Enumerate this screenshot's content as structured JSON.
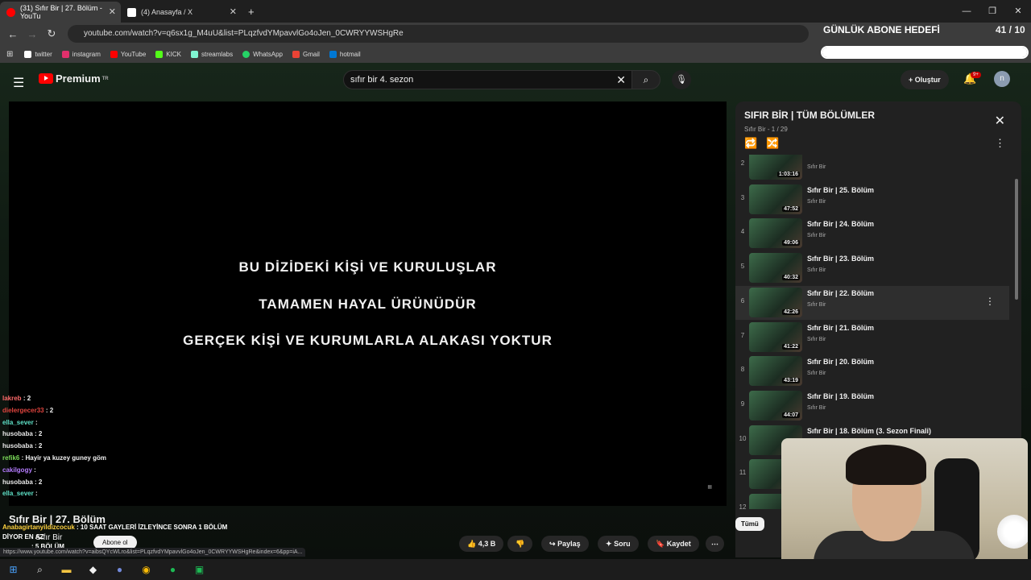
{
  "browser": {
    "tabs": [
      {
        "title": "(31) Sıfır Bir | 27. Bölüm - YouTu",
        "color": "#ff0000"
      },
      {
        "title": "(4) Anasayfa / X",
        "color": "#ffffff"
      }
    ],
    "url": "youtube.com/watch?v=q6sx1g_M4uU&list=PLqzfvdYMpavvlGo4oJen_0CWRYYWSHgRe",
    "bookmarks": [
      {
        "label": "twitter",
        "color": "#ffffff"
      },
      {
        "label": "instagram",
        "color": "#e1306c"
      },
      {
        "label": "YouTube",
        "color": "#ff0000"
      },
      {
        "label": "KICK",
        "color": "#53fc18"
      },
      {
        "label": "streamlabs",
        "color": "#80f5d2"
      },
      {
        "label": "WhatsApp",
        "color": "#25d366"
      },
      {
        "label": "Gmail",
        "color": "#ea4335"
      },
      {
        "label": "hotmail",
        "color": "#0078d4"
      }
    ]
  },
  "youtube": {
    "logo_text": "Premium",
    "logo_sup": "TR",
    "search_value": "sıfır bir 4. sezon",
    "create_label": "Oluştur",
    "notif_badge": "9+",
    "avatar_letter": "n"
  },
  "video": {
    "captions": [
      "BU DİZİDEKİ KİŞİ VE KURULUŞLAR",
      "TAMAMEN HAYAL ÜRÜNÜDÜR",
      "GERÇEK KİŞİ VE KURUMLARLA ALAKASI YOKTUR"
    ],
    "title": "Sıfır Bir | 27. Bölüm",
    "channel": "Sıfır Bir",
    "subscribe_label": "Abone ol",
    "likes": "4,3 B",
    "share_label": "Paylaş",
    "ask_label": "Soru",
    "save_label": "Kaydet"
  },
  "chat": [
    {
      "user": "lakreb",
      "msg": ": 2",
      "color": "#ff6b6b"
    },
    {
      "user": "dielergecer33",
      "msg": ": 2",
      "color": "#e0443e"
    },
    {
      "user": "ella_sever",
      "msg": ":",
      "color": "#5ee0c6"
    },
    {
      "user": "husobaba",
      "msg": ": 2",
      "color": "#e8e8e8"
    },
    {
      "user": "husobaba",
      "msg": ": 2",
      "color": "#e8e8e8"
    },
    {
      "user": "refik6",
      "msg": ": Hayir ya kuzey guney göm",
      "color": "#7cdc5a"
    },
    {
      "user": "cakilgogy",
      "msg": ":",
      "color": "#b57cff"
    },
    {
      "user": "husobaba",
      "msg": ": 2",
      "color": "#e8e8e8"
    },
    {
      "user": "ella_sever",
      "msg": ":",
      "color": "#5ee0c6"
    }
  ],
  "overlay_chat": [
    {
      "user": "Anabagirtanyildizcocuk",
      "msg": ": 10 SAAT GAYLERİ İZLEYİNCE SONRA 1 BÖLÜM"
    },
    {
      "user": "DİYOR EN AZ",
      "msg": ""
    },
    {
      "user": "",
      "msg": ": 5 BÖLÜM"
    }
  ],
  "status_url": "https://www.youtube.com/watch?v=aibsQYcWLro&list=PLqzfvdYMpavvlGo4oJen_0CWRYYWSHgRe&index=6&pp=iA...",
  "playlist": {
    "title": "SIFIR BİR | TÜM BÖLÜMLER",
    "subtitle": "Sıfır Bir - 1 / 29",
    "items": [
      {
        "index": "2",
        "title": "",
        "channel": "Sıfır Bir",
        "duration": "1:03:16"
      },
      {
        "index": "3",
        "title": "Sıfır Bir | 25. Bölüm",
        "channel": "Sıfır Bir",
        "duration": "47:52"
      },
      {
        "index": "4",
        "title": "Sıfır Bir | 24. Bölüm",
        "channel": "Sıfır Bir",
        "duration": "49:06"
      },
      {
        "index": "5",
        "title": "Sıfır Bir | 23. Bölüm",
        "channel": "Sıfır Bir",
        "duration": "40:32"
      },
      {
        "index": "6",
        "title": "Sıfır Bir | 22. Bölüm",
        "channel": "Sıfır Bir",
        "duration": "42:26"
      },
      {
        "index": "7",
        "title": "Sıfır Bir | 21. Bölüm",
        "channel": "Sıfır Bir",
        "duration": "41:22"
      },
      {
        "index": "8",
        "title": "Sıfır Bir | 20. Bölüm",
        "channel": "Sıfır Bir",
        "duration": "43:19"
      },
      {
        "index": "9",
        "title": "Sıfır Bir | 19. Bölüm",
        "channel": "Sıfır Bir",
        "duration": "44:07"
      },
      {
        "index": "10",
        "title": "Sıfır Bir | 18. Bölüm (3. Sezon Finali)",
        "channel": "Sıfır Bir",
        "duration": ""
      },
      {
        "index": "11",
        "title": "",
        "channel": "",
        "duration": ""
      },
      {
        "index": "12",
        "title": "",
        "channel": "",
        "duration": ""
      }
    ],
    "chip_label": "Tümü"
  },
  "stream_overlay": {
    "goal_label": "GÜNLÜK ABONE HEDEFİ",
    "goal_count": "41 / 10",
    "goal_progress": 1.0
  }
}
